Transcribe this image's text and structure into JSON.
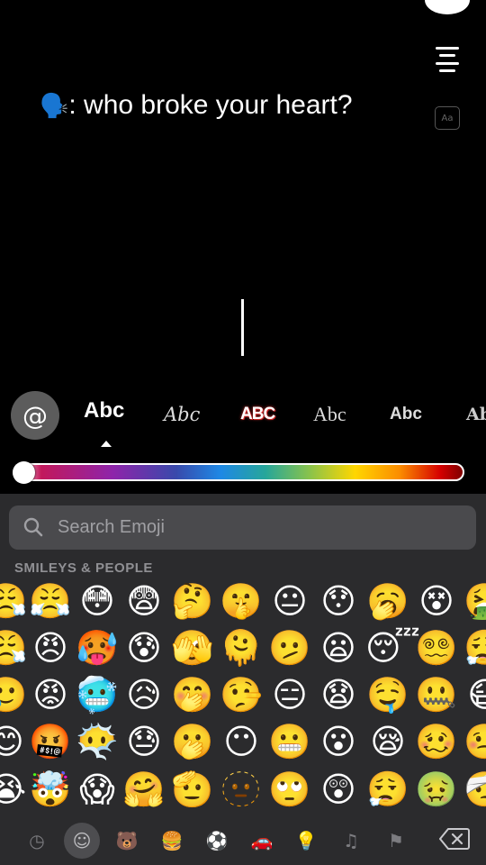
{
  "caption": {
    "speaker_emoji": "🗣️",
    "text": ": who broke your heart?"
  },
  "toolbar": {
    "font_button_label": "Aa",
    "align_icon": "align-center-icon",
    "close_icon": "close-icon"
  },
  "styles": {
    "mention_label": "@",
    "options": [
      "Abc",
      "Abc",
      "ABC",
      "Abc",
      "Abc",
      "Ab"
    ],
    "selected_index": 0
  },
  "color_slider": {
    "value": 0
  },
  "emoji_keyboard": {
    "search": {
      "placeholder": "Search Emoji",
      "value": ""
    },
    "section_title": "SMILEYS & PEOPLE",
    "grid": [
      [
        "😤",
        "😤",
        "😳",
        "😨",
        "🤔",
        "🤫",
        "😐",
        "😯",
        "🥱",
        "😵",
        "🤮"
      ],
      [
        "😤",
        "😠",
        "🥵",
        "😰",
        "🫣",
        "🫠",
        "🫤",
        "😦",
        "😴",
        "😵‍💫",
        "😮‍💨"
      ],
      [
        "🥲",
        "😡",
        "🥶",
        "😥",
        "🤭",
        "🤥",
        "😑",
        "😧",
        "🤤",
        "🤐",
        "😷"
      ],
      [
        "😊",
        "🤬",
        "😶‍🌫️",
        "😓",
        "🫢",
        "😶",
        "😬",
        "😮",
        "😪",
        "🥴",
        "🤒"
      ],
      [
        "😭",
        "🤯",
        "😱",
        "🤗",
        "🫡",
        "🫥",
        "🙄",
        "😲",
        "😮‍💨",
        "🤢",
        "🤕"
      ]
    ],
    "categories": [
      {
        "icon": "clock-icon",
        "glyph": "◷"
      },
      {
        "icon": "smiley-icon",
        "glyph": "☺"
      },
      {
        "icon": "bear-icon",
        "glyph": "🐻"
      },
      {
        "icon": "food-icon",
        "glyph": "🍔"
      },
      {
        "icon": "ball-icon",
        "glyph": "⚽"
      },
      {
        "icon": "car-icon",
        "glyph": "🚗"
      },
      {
        "icon": "bulb-icon",
        "glyph": "💡"
      },
      {
        "icon": "symbols-icon",
        "glyph": "♫"
      },
      {
        "icon": "flag-icon",
        "glyph": "⚑"
      }
    ],
    "active_category": 1,
    "delete_icon": "backspace-icon"
  }
}
